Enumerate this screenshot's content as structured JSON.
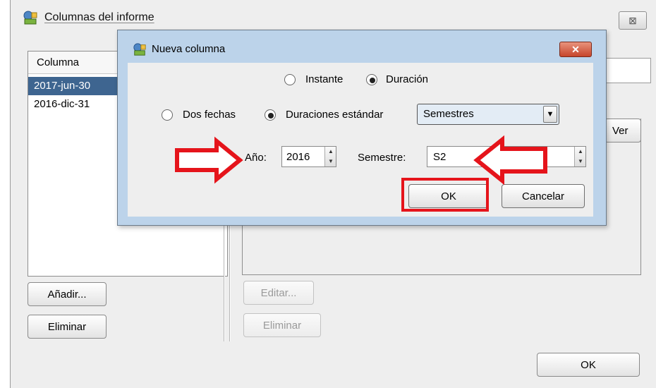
{
  "background_window": {
    "title": "Columnas del informe",
    "close_glyph": "⊠",
    "column_list": {
      "header": "Columna",
      "rows": [
        "2017-jun-30",
        "2016-dic-31"
      ],
      "selected_index": 0
    },
    "left_buttons": {
      "add_label": "Añadir...",
      "remove_label": "Eliminar"
    },
    "right_buttons": {
      "edit_label": "Editar...",
      "remove_label": "Eliminar",
      "view_label": "Ver"
    },
    "ok_label": "OK"
  },
  "dialog": {
    "title": "Nueva columna",
    "close_glyph": "✕",
    "mode_options": [
      {
        "label": "Instante",
        "selected": false
      },
      {
        "label": "Duración",
        "selected": true
      }
    ],
    "duration_options": [
      {
        "label": "Dos fechas",
        "selected": false
      },
      {
        "label": "Duraciones estándar",
        "selected": true
      }
    ],
    "period_select": {
      "value": "Semestres",
      "arrow_glyph": "▼"
    },
    "year": {
      "label": "Año:",
      "value": "2016"
    },
    "semester": {
      "label": "Semestre:",
      "value": "S2"
    },
    "spin_glyphs": {
      "up": "▲",
      "down": "▼"
    },
    "ok_label": "OK",
    "cancel_label": "Cancelar"
  },
  "annotation_colors": {
    "highlight": "#e5141b"
  },
  "colors": {
    "selection": "#3e6590",
    "dialog_frame": "#bcd3ea",
    "panel": "#eeeeee"
  }
}
